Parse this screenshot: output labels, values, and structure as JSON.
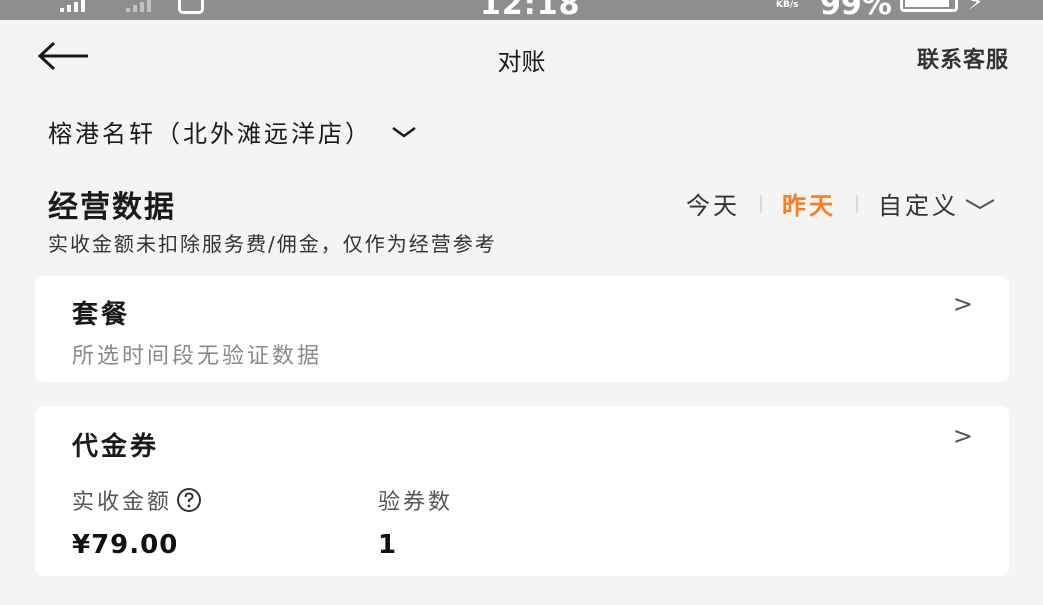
{
  "status_bar": {
    "time": "12:18",
    "speed_unit": "KB/s",
    "battery": "99%"
  },
  "nav": {
    "title": "对账",
    "right_link": "联系客服"
  },
  "store": {
    "name": "榕港名轩（北外滩远洋店）"
  },
  "business": {
    "title": "经营数据",
    "tabs": [
      "今天",
      "昨天",
      "自定义"
    ],
    "active_tab": "昨天",
    "note": "实收金额未扣除服务费/佣金，仅作为经营参考"
  },
  "cards": [
    {
      "title": "套餐",
      "arrow": ">",
      "empty_text": "所选时间段无验证数据"
    },
    {
      "title": "代金券",
      "arrow": ">",
      "metrics": [
        {
          "label": "实收金额",
          "value": "¥79.00"
        },
        {
          "label": "验券数",
          "value": "1"
        }
      ]
    }
  ],
  "colors": {
    "accent": "#ff7a1a",
    "background": "#f4f4f4",
    "card": "#ffffff"
  }
}
